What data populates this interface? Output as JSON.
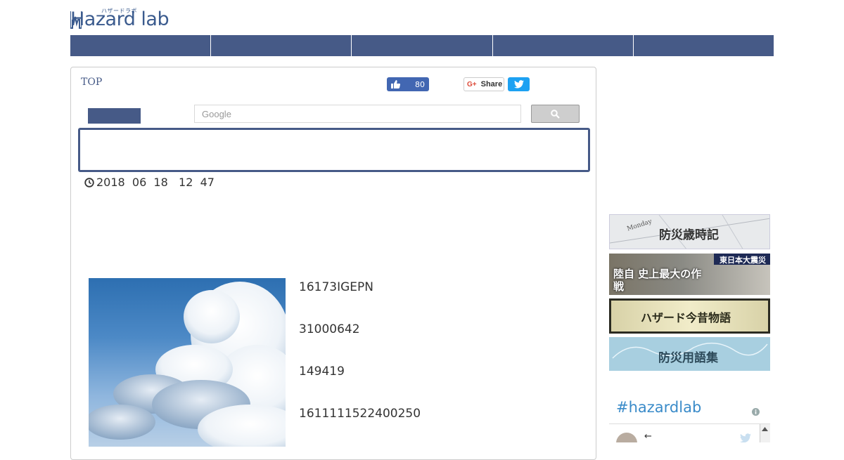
{
  "header": {
    "logo_text": "Hazard lab",
    "logo_subtext": "ハザードラボ"
  },
  "nav": {
    "items": [
      "",
      "",
      "",
      "",
      ""
    ]
  },
  "breadcrumb": "TOP",
  "social": {
    "like_count": "80",
    "gplus_label": "Share",
    "gplus_glyph": "G+"
  },
  "search": {
    "placeholder": "Google",
    "value": ""
  },
  "article": {
    "date": {
      "year": "2018",
      "month": "06",
      "day": "18",
      "hour": "12",
      "minute": "47"
    },
    "meta_lines": [
      "16173IGEPN",
      "31000642",
      "149419",
      "1611111522400250"
    ]
  },
  "sidebar": {
    "banners": [
      "防災歳時記",
      "陸自 史上最大の作戦",
      "ハザード今昔物語",
      "防災用語集"
    ],
    "banner_extra": {
      "b1_word": "Monday",
      "b2_badge": "東日本大震災"
    },
    "hashtag": "#hazardlab",
    "feed_arrow": "←"
  },
  "colors": {
    "brand": "#465a87",
    "twitter": "#1da1f2",
    "facebook": "#4267b2",
    "hashtag": "#3a8bc9"
  },
  "icons": [
    "thumbs-up-icon",
    "twitter-bird-icon",
    "search-icon",
    "clock-icon",
    "info-icon"
  ]
}
